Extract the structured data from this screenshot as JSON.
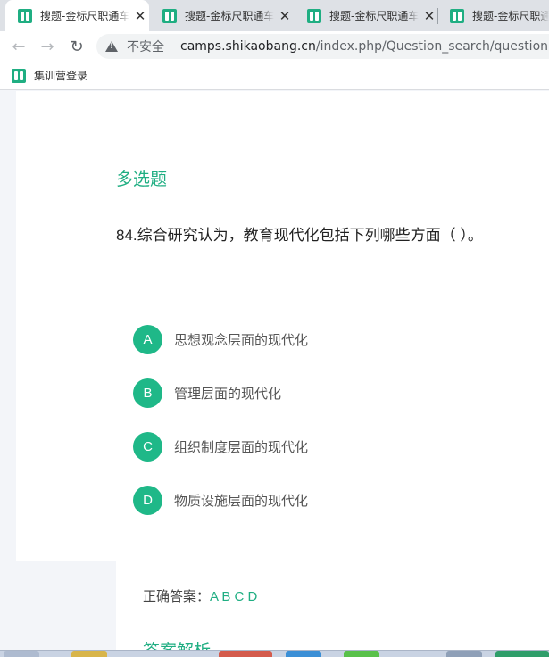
{
  "browser": {
    "tabs": [
      {
        "title": "搜题-金标尺职通车",
        "active": true
      },
      {
        "title": "搜题-金标尺职通车",
        "active": false
      },
      {
        "title": "搜题-金标尺职通车",
        "active": false
      },
      {
        "title": "搜题-金标尺职通车",
        "active": false
      }
    ],
    "insecure_label": "不安全",
    "url_host": "camps.shikaobang.cn",
    "url_path": "/index.php/Question_search/question?qi",
    "bookmark": "集训营登录"
  },
  "question": {
    "type": "多选题",
    "text": "84.综合研究认为，教育现代化包括下列哪些方面（   ）。",
    "options": [
      {
        "letter": "A",
        "text": "思想观念层面的现代化"
      },
      {
        "letter": "B",
        "text": "管理层面的现代化"
      },
      {
        "letter": "C",
        "text": "组织制度层面的现代化"
      },
      {
        "letter": "D",
        "text": "物质设施层面的现代化"
      }
    ]
  },
  "answer": {
    "label": "正确答案：",
    "value": "A B C D",
    "analysis_title": "答案解析"
  },
  "colors": {
    "accent": "#1fae82",
    "option_circle": "#1fb888"
  }
}
